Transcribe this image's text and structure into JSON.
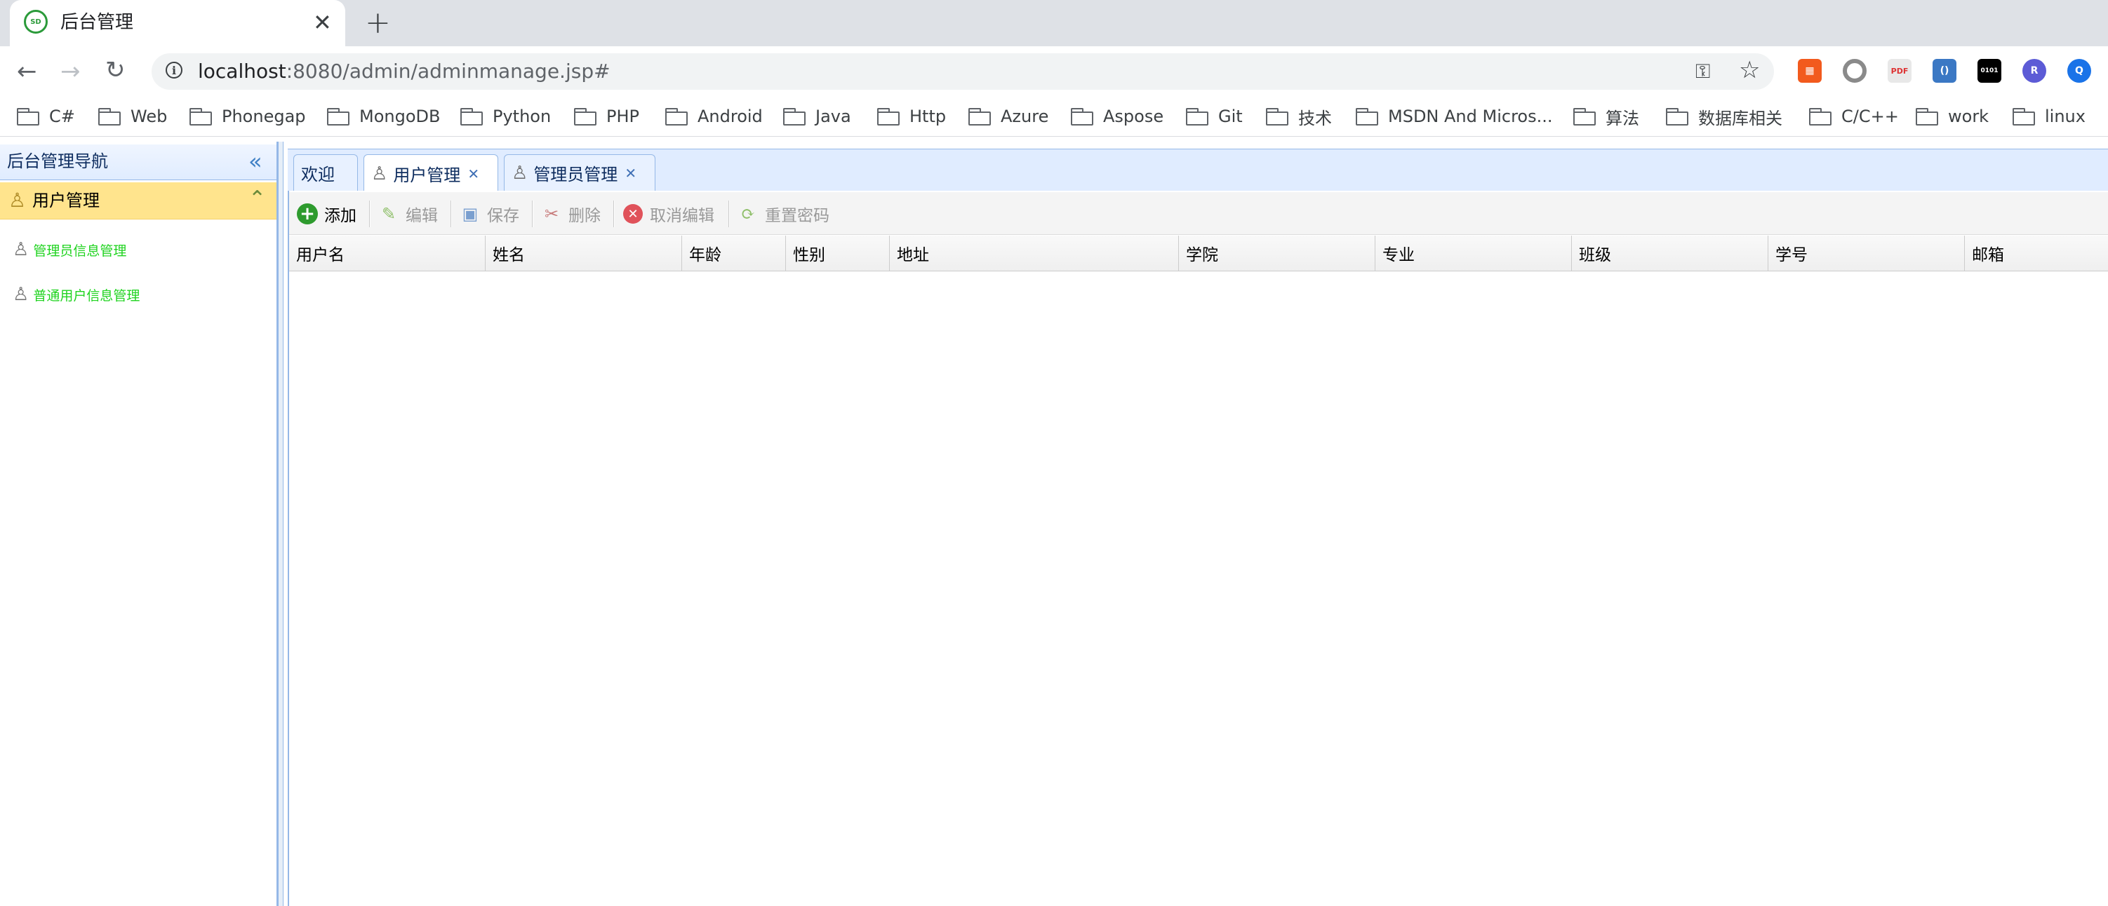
{
  "browser": {
    "tab_title": "后台管理",
    "favicon_text": "SD",
    "url_host": "localhost",
    "url_rest": ":8080/admin/adminmanage.jsp#",
    "bookmarks": [
      "C#",
      "Web",
      "Phonegap",
      "MongoDB",
      "Python",
      "PHP",
      "Android",
      "Java",
      "Http",
      "Azure",
      "Aspose",
      "Git",
      "技术",
      "MSDN And Micros...",
      "算法",
      "数据库相关",
      "C/C++",
      "work",
      "linux"
    ],
    "extensions": [
      {
        "name": "calendar-ext-icon",
        "color": "#f25a1d",
        "text": "▦"
      },
      {
        "name": "circle-ext-icon",
        "color": "#8a8a8a",
        "text": ""
      },
      {
        "name": "pdf-ext-icon",
        "color": "#e8e8e8",
        "text": "PDF"
      },
      {
        "name": "odata-ext-icon",
        "color": "#3b78c4",
        "text": "()"
      },
      {
        "name": "binary-ext-icon",
        "color": "#000000",
        "text": "0101"
      },
      {
        "name": "r-ext-icon",
        "color": "#5c5bd6",
        "text": "R"
      },
      {
        "name": "search-ext-icon",
        "color": "#1a73e8",
        "text": "Q"
      }
    ]
  },
  "sidebar": {
    "title": "后台管理导航",
    "panel_title": "用户管理",
    "items": [
      {
        "label": "管理员信息管理"
      },
      {
        "label": "普通用户信息管理"
      }
    ]
  },
  "tabs": [
    {
      "label": "欢迎",
      "closable": false
    },
    {
      "label": "用户管理",
      "closable": true,
      "active": true
    },
    {
      "label": "管理员管理",
      "closable": true
    }
  ],
  "toolbar": {
    "add": "添加",
    "edit": "编辑",
    "save": "保存",
    "delete": "删除",
    "cancel_edit": "取消编辑",
    "reset_password": "重置密码"
  },
  "grid": {
    "columns": [
      "用户名",
      "姓名",
      "年龄",
      "性别",
      "地址",
      "学院",
      "专业",
      "班级",
      "学号",
      "邮箱"
    ]
  }
}
